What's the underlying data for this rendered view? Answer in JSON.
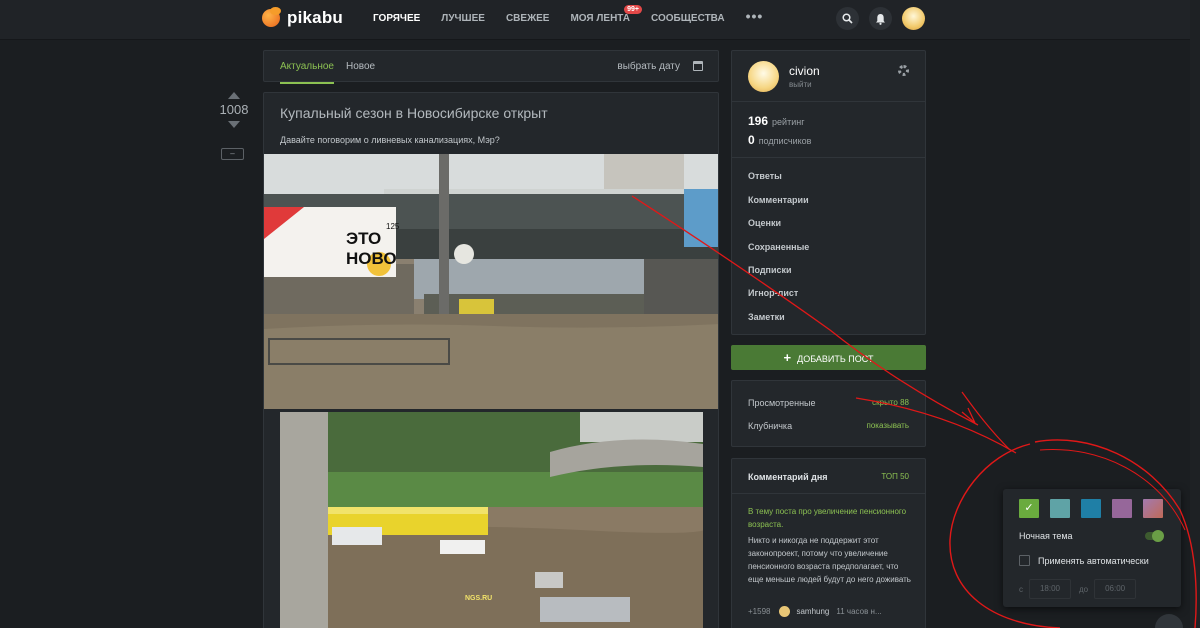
{
  "header": {
    "logo_text": "pikabu",
    "nav": [
      "ГОРЯЧЕЕ",
      "ЛУЧШЕЕ",
      "СВЕЖЕЕ",
      "МОЯ ЛЕНТА",
      "СООБЩЕСТВА"
    ],
    "feed_badge": "99+",
    "more": "•••"
  },
  "tabs": {
    "current": "Актуальное",
    "new": "Новое",
    "date": "выбрать дату"
  },
  "vote": {
    "rating": "1008",
    "hide": "–"
  },
  "post": {
    "title": "Купальный сезон в Новосибирске открыт",
    "text": "Давайте поговорим о ливневых канализациях, Мэр?",
    "billboard_line1": "ЭТО",
    "billboard_line2": "НОВО",
    "billboard_side": "125",
    "watermark": "NGS.RU"
  },
  "profile": {
    "username": "civion",
    "logout": "выйти",
    "rating_value": "196",
    "rating_label": "рейтинг",
    "subscribers_value": "0",
    "subscribers_label": "подписчиков",
    "links": [
      "Ответы",
      "Комментарии",
      "Оценки",
      "Сохраненные",
      "Подписки",
      "Игнор-лист",
      "Заметки"
    ]
  },
  "add_post": "ДОБАВИТЬ ПОСТ",
  "filters": {
    "viewed_label": "Просмотренные",
    "viewed_value": "скрыто 88",
    "nsfw_label": "Клубничка",
    "nsfw_value": "показывать"
  },
  "comment_of_day": {
    "title": "Комментарий дня",
    "top": "ТОП 50",
    "link": "В тему поста про увеличение пенсионного возраста.",
    "text": "Никто и никогда не поддержит этот законопроект, потому что увеличение пенсионного возраста предполагает, что еще меньше людей будут до него доживать",
    "score": "+1598",
    "user": "samhung",
    "time": "11 часов н..."
  },
  "theme_panel": {
    "swatch_colors": [
      "#6aab3e",
      "#5fa3a6",
      "#1f7fa6",
      "#96679a",
      "#c06a58"
    ],
    "night_label": "Ночная тема",
    "night_enabled": true,
    "auto_label": "Применять автоматически",
    "from_label": "с",
    "from_time": "18:00",
    "to_label": "до",
    "to_time": "06:00"
  },
  "colors": {
    "accent": "#8cc152",
    "button_green": "#4a7a35",
    "background": "#1b1e21",
    "card": "#23272b",
    "annotation_red": "#e01818"
  }
}
